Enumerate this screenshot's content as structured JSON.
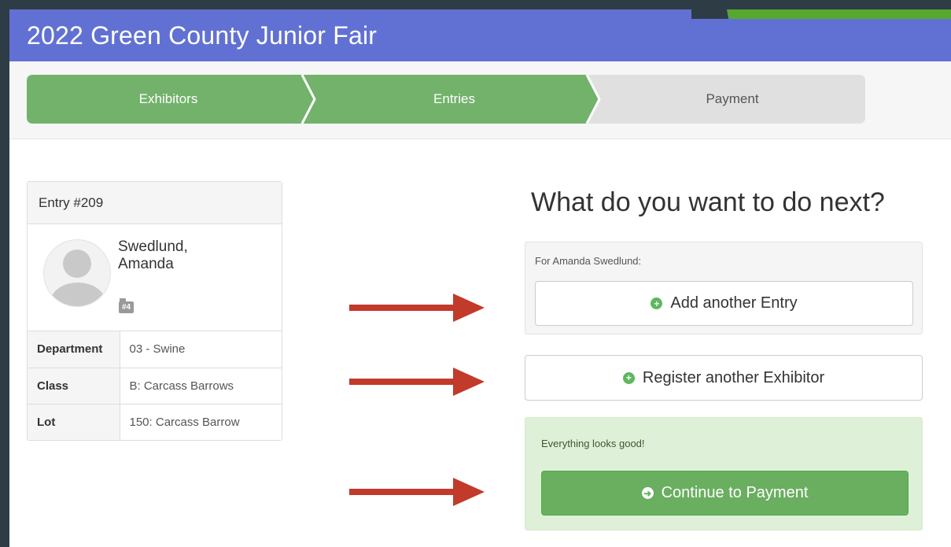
{
  "app": {
    "title": "2022 Green County Junior Fair"
  },
  "steps": [
    {
      "label": "Exhibitors",
      "state": "complete"
    },
    {
      "label": "Entries",
      "state": "complete"
    },
    {
      "label": "Payment",
      "state": "inactive"
    }
  ],
  "entry_card": {
    "title": "Entry #209",
    "exhibitor_name": "Swedlund, Amanda",
    "badge": "#4",
    "rows": [
      {
        "key": "Department",
        "value": "03 - Swine"
      },
      {
        "key": "Class",
        "value": "B: Carcass Barrows"
      },
      {
        "key": "Lot",
        "value": "150: Carcass Barrow"
      }
    ]
  },
  "next": {
    "heading": "What do you want to do next?",
    "for_label": "For Amanda Swedlund:",
    "add_entry_label": "Add another Entry",
    "register_label": "Register another Exhibitor",
    "status_text": "Everything looks good!",
    "continue_label": "Continue to Payment"
  },
  "colors": {
    "header": "#6171d3",
    "step_complete": "#72b26b",
    "step_inactive": "#e0e0e0",
    "arrow": "#c23a2a",
    "success_bg": "#dff0d8",
    "success_button": "#6aae60"
  }
}
